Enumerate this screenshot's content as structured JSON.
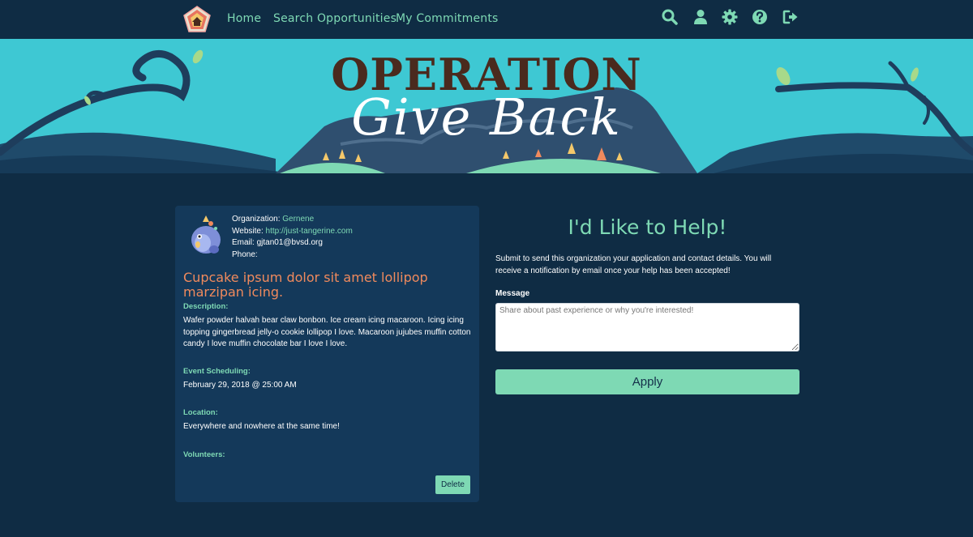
{
  "nav": {
    "home": "Home",
    "search": "Search Opportunities",
    "commitments": "My Commitments",
    "icons": [
      "search-icon",
      "user-icon",
      "gear-icon",
      "help-icon",
      "logout-icon"
    ]
  },
  "banner": {
    "title": "OPERATION",
    "subtitle": "Give Back"
  },
  "organization": {
    "org_label": "Organization:",
    "org_name": "Gernene",
    "website_label": "Website:",
    "website": "http://just-tangerine.com",
    "email_label": "Email:",
    "email": "gjtan01@bvsd.org",
    "phone_label": "Phone:",
    "phone": ""
  },
  "event": {
    "title": "Cupcake ipsum dolor sit amet lollipop marzipan icing.",
    "description_label": "Description:",
    "description": "Wafer powder halvah bear claw bonbon. Ice cream icing macaroon. Icing icing topping gingerbread jelly-o cookie lollipop I love. Macaroon jujubes muffin cotton candy I love muffin chocolate bar I love I love.",
    "scheduling_label": "Event Scheduling:",
    "scheduling": "February 29, 2018 @ 25:00 AM",
    "location_label": "Location:",
    "location": "Everywhere and nowhere at the same time!",
    "volunteers_label": "Volunteers:",
    "delete_label": "Delete"
  },
  "help_form": {
    "title": "I'd Like to Help!",
    "description": "Submit to send this organization your application and contact details. You will receive a notification by email once your help has been accepted!",
    "message_label": "Message",
    "message_placeholder": "Share about past experience or why you're interested!",
    "apply_label": "Apply"
  },
  "colors": {
    "background": "#0f2c44",
    "card": "#14395a",
    "accent": "#7ed9b4",
    "title_orange": "#f08a5d",
    "banner_sky": "#3ec8d3",
    "banner_title": "#4a2a1e"
  }
}
